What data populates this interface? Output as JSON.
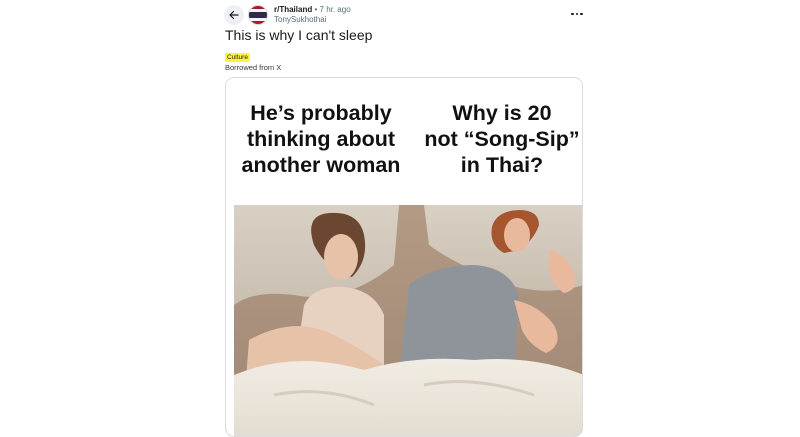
{
  "post": {
    "subreddit": "r/Thailand",
    "separator": "•",
    "time_ago": "7 hr. ago",
    "author": "TonySukhothai",
    "title": "This is why I can't sleep",
    "flair": "Culture",
    "body": "Borrowed from X"
  },
  "meme": {
    "left_caption": "He’s probably\nthinking about\nanother woman",
    "right_caption": "Why is 20\nnot “Song-Sip”\nin Thai?"
  },
  "icons": {
    "back": "arrow-left-icon",
    "subreddit_avatar": "thailand-flag-icon",
    "more": "more-horizontal-icon"
  },
  "colors": {
    "flair_bg": "#fbf33d",
    "meta_text": "#576f76"
  }
}
